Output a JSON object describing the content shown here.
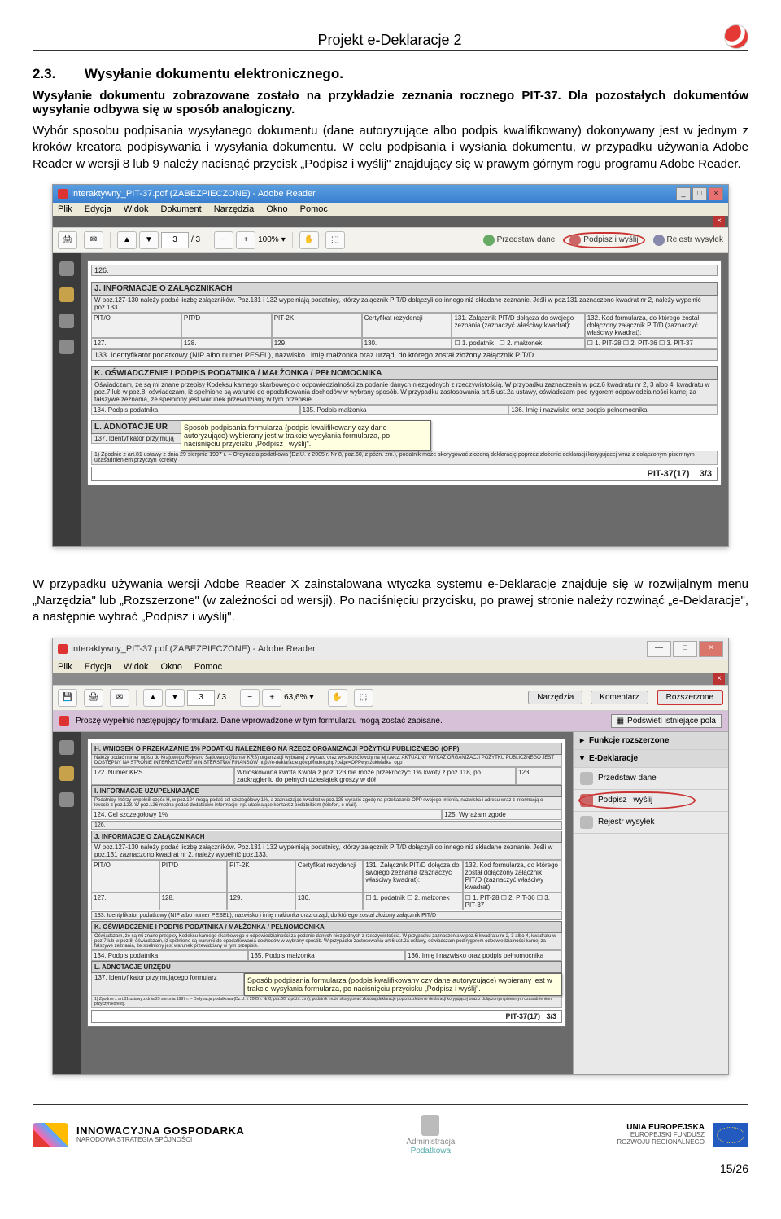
{
  "header": {
    "project_title": "Projekt e-Deklaracje 2"
  },
  "content": {
    "section_num": "2.3.",
    "section_title": "Wysyłanie dokumentu elektronicznego.",
    "intro_bold": "Wysyłanie dokumentu zobrazowane zostało na przykładzie zeznania rocznego PIT-37. Dla pozostałych dokumentów wysyłanie odbywa się w sposób analogiczny.",
    "para1": "Wybór sposobu podpisania wysyłanego dokumentu (dane autoryzujące albo podpis kwalifikowany) dokonywany jest w jednym z kroków kreatora podpisywania i wysyłania dokumentu. W celu podpisania i wysłania dokumentu, w przypadku używania Adobe Reader w wersji 8 lub 9 należy nacisnąć przycisk „Podpisz i wyślij\" znajdujący się w prawym górnym rogu programu Adobe Reader.",
    "para2": "W przypadku używania wersji Adobe Reader X zainstalowana wtyczka systemu e-Deklaracje znajduje się w rozwijalnym menu „Narzędzia\" lub „Rozszerzone\" (w zależności od wersji). Po naciśnięciu przycisku, po prawej stronie należy rozwinąć „e-Deklaracje\", a następnie wybrać „Podpisz i wyślij\"."
  },
  "shot1": {
    "title": "Interaktywny_PIT-37.pdf (ZABEZPIECZONE) - Adobe Reader",
    "menu": {
      "plik": "Plik",
      "edycja": "Edycja",
      "widok": "Widok",
      "dokument": "Dokument",
      "narzedzia": "Narzędzia",
      "okno": "Okno",
      "pomoc": "Pomoc"
    },
    "page_cur": "3",
    "page_of": "/ 3",
    "zoom": "100%",
    "przedstaw": "Przedstaw dane",
    "podpisz": "Podpisz i wyślij",
    "rejestr": "Rejestr wysyłek",
    "form": {
      "pos126": "126.",
      "sectJ_head": "J. INFORMACJE O ZAŁĄCZNIKACH",
      "sectJ_sub": "W poz.127-130 należy podać liczbę załączników. Poz.131 i 132 wypełniają podatnicy, którzy załącznik PIT/D dołączyli do innego niż składane zeznanie. Jeśli w poz.131 zaznaczono kwadrat nr 2, należy wypełnić poz.133.",
      "colA": "PIT/O",
      "colB": "PIT/D",
      "colC": "PIT-2K",
      "colD": "Certyfikat rezydencji",
      "c131": "131. Załącznik PIT/D dołącza do swojego zeznania (zaznaczyć właściwy kwadrat):",
      "c132": "132. Kod formularza, do którego został dołączony załącznik PIT/D (zaznaczyć właściwy kwadrat):",
      "p127": "127.",
      "p128": "128.",
      "p129": "129.",
      "p130": "130.",
      "chk1": "1. podatnik",
      "chk2": "2. małżonek",
      "chk3": "1. PIT-28",
      "chk4": "2. PIT-36",
      "chk5": "3. PIT-37",
      "p133": "133. Identyfikator podatkowy (NIP albo numer PESEL), nazwisko i imię małżonka oraz urząd, do którego został złożony załącznik PIT/D",
      "sectK_head": "K. OŚWIADCZENIE I PODPIS PODATNIKA / MAŁŻONKA / PEŁNOMOCNIKA",
      "sectK_sub": "Oświadczam, że są mi znane przepisy Kodeksu karnego skarbowego o odpowiedzialności za podanie danych niezgodnych z rzeczywistością. W przypadku zaznaczenia w poz.6 kwadratu nr 2, 3 albo 4, kwadratu w poz.7 lub w poz.8, oświadczam, iż spełnione są warunki do opodatkowania dochodów w wybrany sposób. W przypadku zastosowania art.6 ust.2a ustawy, oświadczam pod rygorem odpowiedzialności karnej za fałszywe zeznania, że spełniony jest warunek przewidziany w tym przepisie.",
      "p134": "134. Podpis podatnika",
      "p135": "135. Podpis małżonka",
      "p136": "136. Imię i nazwisko oraz podpis pełnomocnika",
      "sectL_head": "L. ADNOTACJE UR",
      "p137": "137. Identyfikator przyjmują",
      "tooltip": "Sposób podpisania formularza (podpis kwalifikowany czy dane autoryzujące) wybierany jest w trakcie wysyłania formularza, po naciśnięciu przycisku „Podpisz i wyślij\".",
      "foot1": "1) Zgodnie z art.81 ustawy z dnia 29 sierpnia 1997 r. – Ordynacja podatkowa (Dz.U. z 2005 r. Nr 8, poz.60, z późn. zm.), podatnik może skorygować złożoną deklarację poprzez złożenie deklaracji korygującej wraz z dołączonym pisemnym uzasadnieniem przyczyn korekty.",
      "pit": "PIT-37(17)",
      "pitpg": "3/3"
    }
  },
  "shot2": {
    "title": "Interaktywny_PIT-37.pdf (ZABEZPIECZONE) - Adobe Reader",
    "menu": {
      "plik": "Plik",
      "edycja": "Edycja",
      "widok": "Widok",
      "okno": "Okno",
      "pomoc": "Pomoc"
    },
    "page_cur": "3",
    "page_of": "/ 3",
    "zoom": "63,6%",
    "tabs": {
      "narzedzia": "Narzędzia",
      "komentarz": "Komentarz",
      "rozszerzone": "Rozszerzone"
    },
    "purplebar": "Proszę wypełnić następujący formularz. Dane wprowadzone w tym formularzu mogą zostać zapisane.",
    "podswietl": "Podświetl istniejące pola",
    "right": {
      "funkcje": "Funkcje rozszerzone",
      "edek": "E-Deklaracje",
      "przedstaw": "Przedstaw dane",
      "podpisz": "Podpisz i wyślij",
      "rejestr": "Rejestr wysyłek"
    },
    "form": {
      "sectH": "H. WNIOSEK O PRZEKAZANIE 1% PODATKU NALEŻNEGO NA RZECZ ORGANIZACJI POŻYTKU PUBLICZNEGO (OPP)",
      "sectH_sub": "Należy podać numer wpisu do Krajowego Rejestru Sądowego (Numer KRS) organizacji wybranej z wykazu oraz wysokość kwoty na jej rzecz. AKTUALNY WYKAZ ORGANIZACJI POŻYTKU PUBLICZNEGO JEST DOSTĘPNY NA STRONIE INTERNETOWEJ MINISTERSTWA FINANSÓW http://e-deklaracje.gov.pl/index.php?page=OPPwyszukiwarka_opp",
      "p122": "122. Numer KRS",
      "p123": "Wnioskowana kwota Kwota z poz.123 nie może przekroczyć 1% kwoty z poz.118, po zaokrągleniu do pełnych dziesiątek groszy w dół",
      "p123n": "123.",
      "sectI": "I. INFORMACJE UZUPEŁNIAJĄCE",
      "sectI_sub": "Podatnicy, którzy wypełnili część H, w poz.124 mogą podać cel szczegółowy 1%, a zaznaczając kwadrat w poz.125 wyrazić zgodę na przekazanie OPP swojego imienia, nazwiska i adresu wraz z informacją o kwocie z poz.123. W poz.126 można podać dodatkowe informacje, np. ułatwiające kontakt z podatnikiem (telefon, e-mail).",
      "p124": "124. Cel szczegółowy 1%",
      "p125": "125. Wyrażam zgodę",
      "p126": "126.",
      "sectJ": "J. INFORMACJE O ZAŁĄCZNIKACH",
      "sectK": "K. OŚWIADCZENIE I PODPIS PODATNIKA / MAŁŻONKA / PEŁNOMOCNIKA",
      "sectL": "L. ADNOTACJE URZĘDU",
      "p137": "137. Identyfikator przyjmującego formularz",
      "tooltip": "Sposób podpisania formularza (podpis kwalifikowany czy dane autoryzujące) wybierany jest w trakcie wysyłania formularza, po naciśnięciu przycisku „Podpisz i wyślij\".",
      "pit": "PIT-37(17)",
      "pitpg": "3/3"
    }
  },
  "footer": {
    "ig_big": "INNOWACYJNA GOSPODARKA",
    "ig_sub": "NARODOWA STRATEGIA SPÓJNOŚCI",
    "mid1": "Administracja",
    "mid2": "Podatkowa",
    "eu_big": "UNIA EUROPEJSKA",
    "eu_sub1": "EUROPEJSKI FUNDUSZ",
    "eu_sub2": "ROZWOJU REGIONALNEGO",
    "pagenum": "15/26"
  }
}
